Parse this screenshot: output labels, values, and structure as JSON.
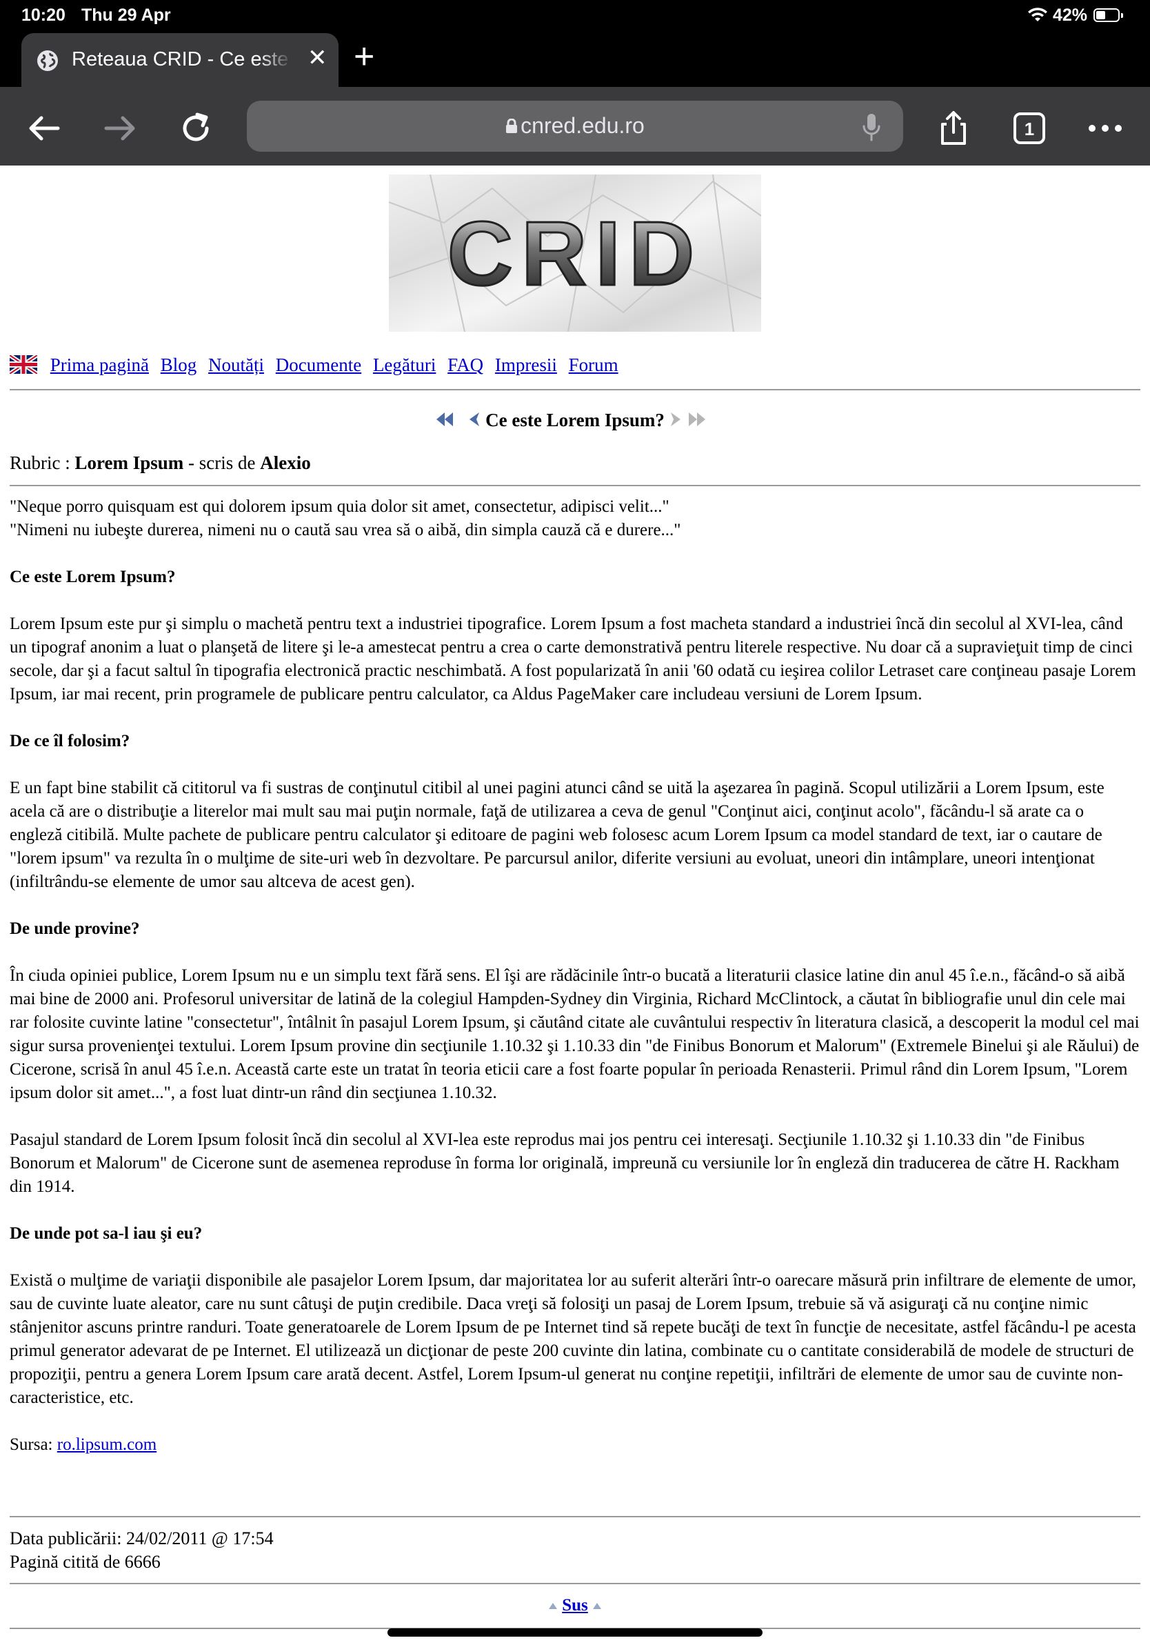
{
  "status_bar": {
    "time": "10:20",
    "date": "Thu 29 Apr",
    "battery": "42%",
    "battery_level": 0.42
  },
  "tab": {
    "title": "Reteaua CRID - Ce este Lorem Ipsum?"
  },
  "address_bar": {
    "url": "cnred.edu.ro"
  },
  "logo": {
    "text": "CRID"
  },
  "nav": {
    "items": [
      {
        "label": "Prima pagină"
      },
      {
        "label": "Blog"
      },
      {
        "label": "Noutăți"
      },
      {
        "label": "Documente"
      },
      {
        "label": "Legături"
      },
      {
        "label": "FAQ"
      },
      {
        "label": "Impresii"
      },
      {
        "label": "Forum"
      }
    ]
  },
  "article": {
    "title": "Ce este Lorem Ipsum?",
    "rubric_label": "Rubric : ",
    "rubric_value": "Lorem Ipsum",
    "written_by": " - scris de ",
    "author": "Alexio",
    "quote_1": "\"Neque porro quisquam est qui dolorem ipsum quia dolor sit amet, consectetur, adipisci velit...\"",
    "quote_2": "\"Nimeni nu iubeşte durerea, nimeni nu o caută sau vrea să o aibă, din simpla cauză că e durere...\"",
    "sections": [
      {
        "heading": "Ce este Lorem Ipsum?",
        "paragraphs": [
          "Lorem Ipsum este pur şi simplu o machetă pentru text a industriei tipografice. Lorem Ipsum a fost macheta standard a industriei încă din secolul al XVI-lea, când un tipograf anonim a luat o planşetă de litere şi le-a amestecat pentru a crea o carte demonstrativă pentru literele respective. Nu doar că a supravieţuit timp de cinci secole, dar şi a facut saltul în tipografia electronică practic neschimbată. A fost popularizată în anii '60 odată cu ieşirea colilor Letraset care conţineau pasaje Lorem Ipsum, iar mai recent, prin programele de publicare pentru calculator, ca Aldus PageMaker care includeau versiuni de Lorem Ipsum."
        ]
      },
      {
        "heading": "De ce îl folosim?",
        "paragraphs": [
          "E un fapt bine stabilit că cititorul va fi sustras de conţinutul citibil al unei pagini atunci când se uită la aşezarea în pagină. Scopul utilizării a Lorem Ipsum, este acela că are o distribuţie a literelor mai mult sau mai puţin normale, faţă de utilizarea a ceva de genul \"Conţinut aici, conţinut acolo\", făcându-l să arate ca o engleză citibilă. Multe pachete de publicare pentru calculator şi editoare de pagini web folosesc acum Lorem Ipsum ca model standard de text, iar o cautare de \"lorem ipsum\" va rezulta în o mulţime de site-uri web în dezvoltare. Pe parcursul anilor, diferite versiuni au evoluat, uneori din intâmplare, uneori intenţionat (infiltrându-se elemente de umor sau altceva de acest gen)."
        ]
      },
      {
        "heading": "De unde provine?",
        "paragraphs": [
          "În ciuda opiniei publice, Lorem Ipsum nu e un simplu text fără sens. El îşi are rădăcinile într-o bucată a literaturii clasice latine din anul 45 î.e.n., făcând-o să aibă mai bine de 2000 ani. Profesorul universitar de latină de la colegiul Hampden-Sydney din Virginia, Richard McClintock, a căutat în bibliografie unul din cele mai rar folosite cuvinte latine \"consectetur\", întâlnit în pasajul Lorem Ipsum, şi căutând citate ale cuvântului respectiv în literatura clasică, a descoperit la modul cel mai sigur sursa provenienţei textului. Lorem Ipsum provine din secţiunile 1.10.32 şi 1.10.33 din \"de Finibus Bonorum et Malorum\" (Extremele Binelui şi ale Răului) de Cicerone, scrisă în anul 45 î.e.n. Această carte este un tratat în teoria eticii care a fost foarte popular în perioada Renasterii. Primul rând din Lorem Ipsum, \"Lorem ipsum dolor sit amet...\", a fost luat dintr-un rând din secţiunea 1.10.32.",
          "Pasajul standard de Lorem Ipsum folosit încă din secolul al XVI-lea este reprodus mai jos pentru cei interesaţi. Secţiunile 1.10.32 şi 1.10.33 din \"de Finibus Bonorum et Malorum\" de Cicerone sunt de asemenea reproduse în forma lor originală, impreună cu versiunile lor în engleză din traducerea de către H. Rackham din 1914."
        ]
      },
      {
        "heading": "De unde pot sa-l iau şi eu?",
        "paragraphs": [
          "Există o mulţime de variaţii disponibile ale pasajelor Lorem Ipsum, dar majoritatea lor au suferit alterări într-o oarecare măsură prin infiltrare de elemente de umor, sau de cuvinte luate aleator, care nu sunt câtuşi de puţin credibile. Daca vreţi să folosiţi un pasaj de Lorem Ipsum, trebuie să vă asiguraţi că nu conţine nimic stânjenitor ascuns printre randuri. Toate generatoarele de Lorem Ipsum de pe Internet tind să repete bucăţi de text în funcţie de necesitate, astfel făcându-l pe acesta primul generator adevarat de pe Internet. El utilizează un dicţionar de peste 200 cuvinte din latina, combinate cu o cantitate considerabilă de modele de structuri de propoziţii, pentru a genera Lorem Ipsum care arată decent. Astfel, Lorem Ipsum-ul generat nu conţine repetiţii, infiltrări de elemente de umor sau de cuvinte non-caracteristice, etc."
        ]
      }
    ],
    "source_label": "Sursa: ",
    "source_link": "ro.lipsum.com",
    "published_label": "Data publicării: ",
    "published_value": "24/02/2011 @ 17:54",
    "read_label": "Pagină citită de ",
    "read_value": "6666"
  },
  "footer": {
    "top_link": "Sus"
  },
  "colors": {
    "link": "#0000cc",
    "chrome_bg": "#000000",
    "toolbar_bg": "#3a3a3c",
    "urlbar_bg": "#636366"
  }
}
